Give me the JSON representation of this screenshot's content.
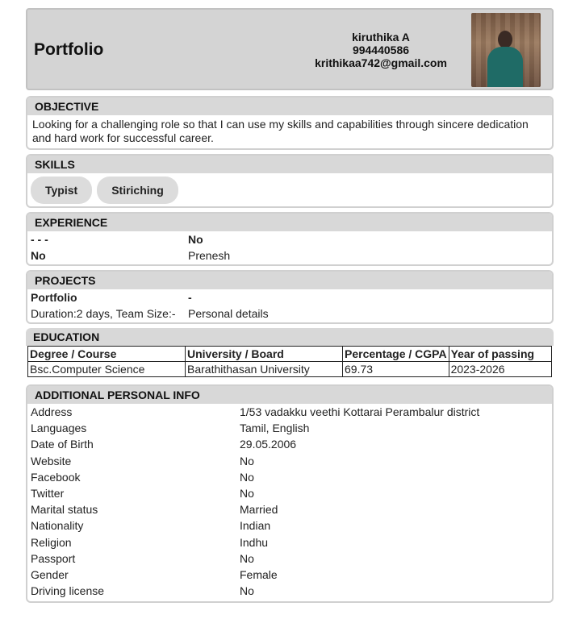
{
  "header": {
    "title": "Portfolio",
    "name": "kiruthika A",
    "phone": "994440586",
    "email": "krithikaa742@gmail.com"
  },
  "objective": {
    "heading": "OBJECTIVE",
    "text": "Looking for a challenging role so that I can use my skills and capabilities through sincere dedication and hard work for successful career."
  },
  "skills": {
    "heading": "SKILLS",
    "items": [
      "Typist",
      "Stiriching"
    ]
  },
  "experience": {
    "heading": "EXPERIENCE",
    "rows": [
      [
        "- - -",
        "No"
      ],
      [
        "No",
        "Prenesh"
      ]
    ]
  },
  "projects": {
    "heading": "PROJECTS",
    "rows": [
      [
        "Portfolio",
        "-"
      ],
      [
        "Duration:2 days, Team Size:-",
        "Personal details"
      ]
    ]
  },
  "education": {
    "heading": "EDUCATION",
    "columns": [
      "Degree / Course",
      "University / Board",
      "Percentage / CGPA",
      "Year of passing"
    ],
    "rows": [
      [
        "Bsc.Computer Science",
        "Barathithasan University",
        "69.73",
        "2023-2026"
      ]
    ]
  },
  "personal": {
    "heading": "ADDITIONAL PERSONAL INFO",
    "rows": [
      [
        "Address",
        "1/53 vadakku veethi Kottarai Perambalur district"
      ],
      [
        "Languages",
        "Tamil, English"
      ],
      [
        "Date of Birth",
        "29.05.2006"
      ],
      [
        "Website",
        "No"
      ],
      [
        "Facebook",
        "No"
      ],
      [
        "Twitter",
        "No"
      ],
      [
        "Marital status",
        "Married"
      ],
      [
        "Nationality",
        "Indian"
      ],
      [
        "Religion",
        "Indhu"
      ],
      [
        "Passport",
        "No"
      ],
      [
        "Gender",
        "Female"
      ],
      [
        "Driving license",
        "No"
      ]
    ]
  }
}
